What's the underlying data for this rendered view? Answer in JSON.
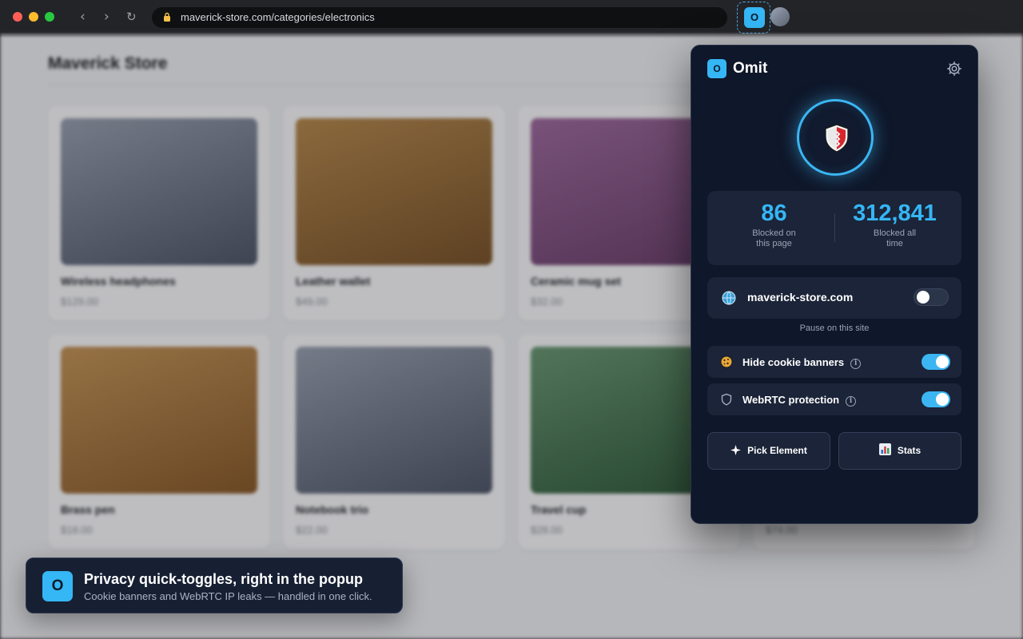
{
  "browser": {
    "url": "maverick-store.com/categories/electronics",
    "nav": {
      "back": "‹",
      "forward": "›",
      "reload": "↻"
    },
    "extension_icon_letter": "O"
  },
  "store": {
    "title": "Maverick Store",
    "products": [
      {
        "name": "Wireless headphones",
        "price": "$129.00",
        "color_a": "#9aa3b1",
        "color_b": "#4e5666"
      },
      {
        "name": "Leather wallet",
        "price": "$49.00",
        "color_a": "#b88a4a",
        "color_b": "#7a5226"
      },
      {
        "name": "Ceramic mug set",
        "price": "$32.00",
        "color_a": "#a06a9e",
        "color_b": "#6a3e6a"
      },
      {
        "name": "Brass pen",
        "price": "$18.00",
        "color_a": "#c89656",
        "color_b": "#8a5a26"
      },
      {
        "name": "Notebook trio",
        "price": "$22.00",
        "color_a": "#9aa3b1",
        "color_b": "#4e5666"
      },
      {
        "name": "Travel cup",
        "price": "$28.00",
        "color_a": "#6a9a72",
        "color_b": "#2e5a38"
      },
      {
        "name": "",
        "price": "$74.00",
        "color_a": "#9aa3b1",
        "color_b": "#4e5666"
      }
    ]
  },
  "popup": {
    "logo_letter": "O",
    "brand": "Omit",
    "stats": {
      "page_count": "86",
      "page_label": "Blocked on this page",
      "total_count": "312,841",
      "total_label": "Blocked all time"
    },
    "site": {
      "domain": "maverick-store.com",
      "paused": false,
      "pause_caption": "Pause on this site"
    },
    "options": [
      {
        "label": "Hide cookie banners",
        "icon": "cookie-icon",
        "enabled": true
      },
      {
        "label": "WebRTC protection",
        "icon": "shield-outline-icon",
        "enabled": true
      }
    ],
    "buttons": {
      "pick_element": "Pick Element",
      "stats": "Stats"
    },
    "colors": {
      "accent": "#35b6f5",
      "panel": "#0f172a",
      "card": "#1b2438"
    }
  },
  "toast": {
    "logo_letter": "O",
    "title": "Privacy quick-toggles, right in the popup",
    "subtitle": "Cookie banners and WebRTC IP leaks — handled in one click."
  }
}
